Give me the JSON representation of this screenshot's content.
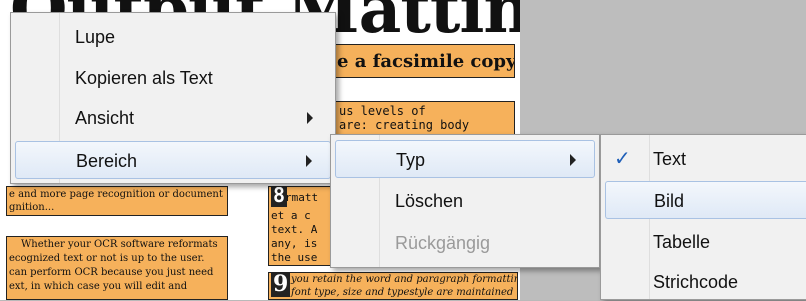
{
  "document": {
    "title_fragment": "Output Matting",
    "line_facsimile": "e a facsimile copy of",
    "line_levels": "us levels of",
    "line_creating": "are: creating body",
    "line_more_recognition": "e and more page recognition or document",
    "line_recognition": "gnition...",
    "line_mat": "rmatt",
    "line_get": "et a c",
    "line_text": "text. A",
    "line_any": "any, is",
    "line_use": "the use",
    "line_whether": "Whether your OCR software reformats",
    "line_recognized": "ecognized text or not is up to the user.",
    "line_perform": "can perform OCR because you just need",
    "line_edit": "ext, in which case you will edit and",
    "line_retain": "you retain the word and paragraph formatting,",
    "line_font": "font type, size and typestyle are maintained",
    "badge_8": "8",
    "badge_9": "9"
  },
  "menu_main": {
    "items": [
      {
        "label": "Lupe"
      },
      {
        "label": "Kopieren als Text"
      },
      {
        "label": "Ansicht"
      },
      {
        "label": "Bereich"
      }
    ]
  },
  "menu_bereich": {
    "items": [
      {
        "label": "Typ"
      },
      {
        "label": "Löschen"
      },
      {
        "label": "Rückgängig"
      }
    ]
  },
  "menu_typ": {
    "check_mark": "✓",
    "items": [
      {
        "label": "Text"
      },
      {
        "label": "Bild"
      },
      {
        "label": "Tabelle"
      },
      {
        "label": "Strichcode"
      }
    ]
  },
  "colors": {
    "highlight": "#f6b15b",
    "selection": "#dfe9f6",
    "check": "#1f5fb8"
  }
}
